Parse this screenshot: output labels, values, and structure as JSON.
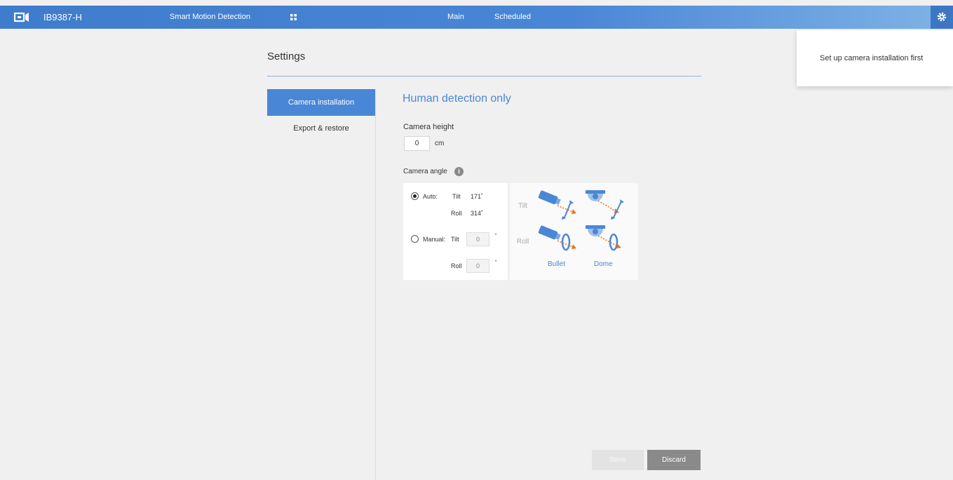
{
  "topbar": {
    "model": "IB9387-H",
    "app_name": "Smart Motion Detection",
    "tabs": [
      "Main",
      "Scheduled"
    ]
  },
  "popover": {
    "text": "Set up camera installation first"
  },
  "settings": {
    "title": "Settings"
  },
  "sidebar": {
    "items": [
      {
        "label": "Camera installation",
        "active": true
      },
      {
        "label": "Export & restore",
        "active": false
      }
    ]
  },
  "main": {
    "section_title": "Human detection only",
    "camera_height": {
      "label": "Camera height",
      "value": "0",
      "unit": "cm"
    },
    "camera_angle": {
      "label": "Camera angle",
      "auto": {
        "label": "Auto:",
        "tilt_label": "Tilt",
        "tilt_value": "171˚",
        "roll_label": "Roll",
        "roll_value": "314˚",
        "selected": true
      },
      "manual": {
        "label": "Manual:",
        "tilt_label": "Tilt",
        "tilt_value": "0",
        "roll_label": "Roll",
        "roll_value": "0",
        "unit": "˚",
        "selected": false
      }
    },
    "diagram": {
      "row_labels": [
        "Tilt",
        "Roll"
      ],
      "col_labels": [
        "Bullet",
        "Dome"
      ]
    }
  },
  "footer": {
    "save_label": "Save",
    "discard_label": "Discard"
  },
  "colors": {
    "accent": "#4a86d6",
    "arrow": "#e8731a"
  }
}
